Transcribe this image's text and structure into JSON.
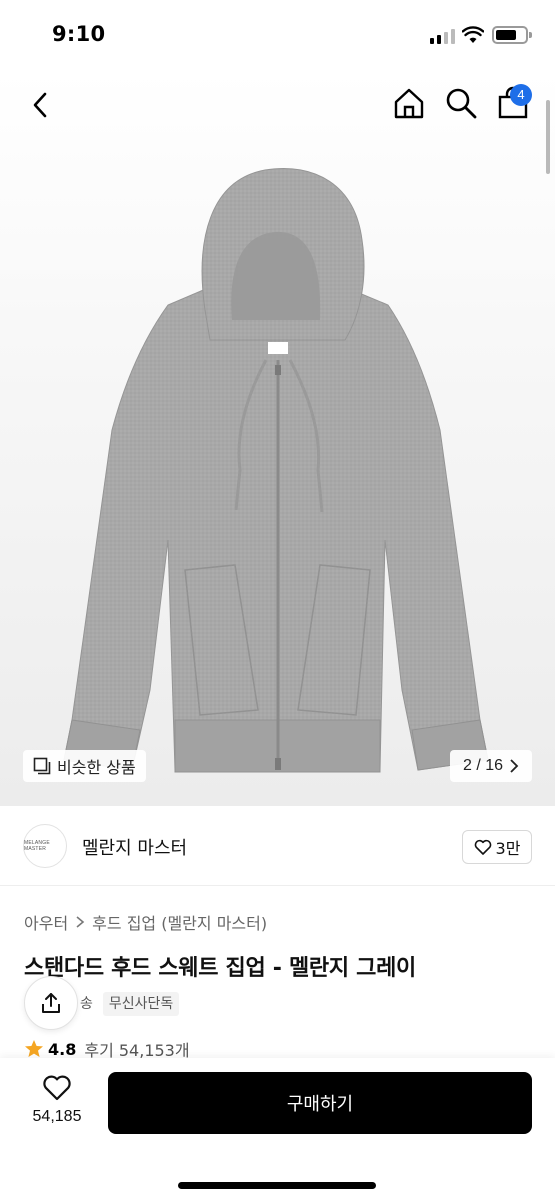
{
  "status_bar": {
    "time": "9:10"
  },
  "header": {
    "cart_count": "4",
    "icons": [
      "back-icon",
      "home-icon",
      "search-icon",
      "shopping-bag-icon"
    ]
  },
  "hero": {
    "image_label": "MELANGE MASTER",
    "similar_label": "비슷한 상품",
    "page_counter": "2 / 16"
  },
  "brand": {
    "logo_text": "MELANGE MASTER",
    "name": "멜란지 마스터",
    "likes": "3만"
  },
  "product": {
    "breadcrumb": [
      "아우터",
      "후드 집업 (멜란지 마스터)"
    ],
    "title": "스탠다드 후드 스웨트 집업 - 멜란지 그레이",
    "tags": [
      "송",
      "무신사단독"
    ],
    "rating": "4.8",
    "reviews": "후기 54,153개"
  },
  "bottom_bar": {
    "wish_count": "54,185",
    "buy_label": "구매하기"
  },
  "colors": {
    "accent": "#1e6ee8",
    "buy_button": "#000000",
    "hoodie": "#a9a9a9",
    "star": "#f5a623"
  }
}
